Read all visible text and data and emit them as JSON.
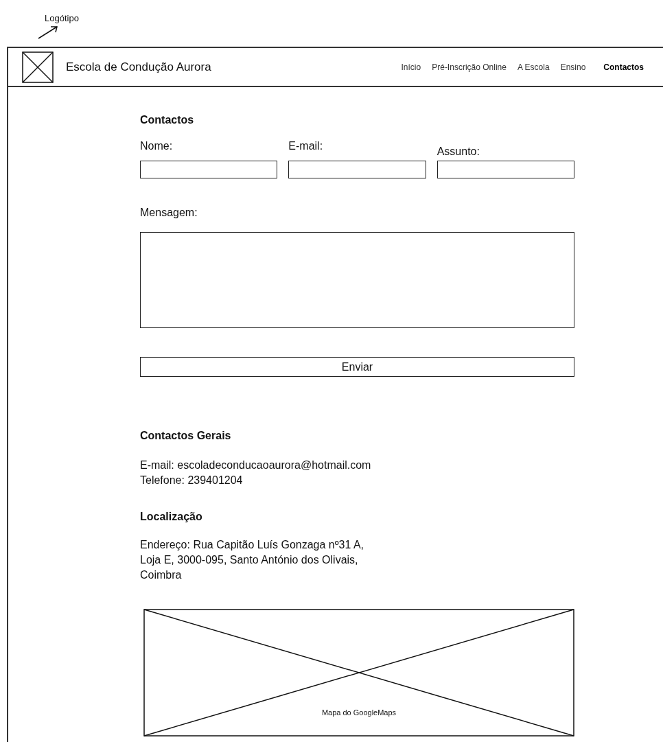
{
  "annotation": {
    "label": "Logótipo"
  },
  "header": {
    "site_name": "Escola de Condução Aurora",
    "nav": [
      {
        "label": "Início",
        "selected": false
      },
      {
        "label": "Pré-Inscrição Online",
        "selected": false
      },
      {
        "label": "A Escola",
        "selected": false
      },
      {
        "label": "Ensino",
        "selected": false
      },
      {
        "label": "Contactos",
        "selected": true
      }
    ]
  },
  "form": {
    "title": "Contactos",
    "fields": [
      {
        "label": "Nome:"
      },
      {
        "label": "E-mail:"
      },
      {
        "label": "Assunto:"
      }
    ],
    "message_label": "Mensagem:",
    "submit": "Enviar"
  },
  "general": {
    "title": "Contactos Gerais",
    "lines": [
      "E-mail: escoladeconducaoaurora@hotmail.com",
      "Telefone: 239401204"
    ]
  },
  "location": {
    "title": "Localização",
    "address": "Endereço: Rua Capitão Luís Gonzaga nº31 A, Loja E, 3000-095, Santo António dos Olivais, Coimbra",
    "map_caption": "Mapa do GoogleMaps"
  }
}
